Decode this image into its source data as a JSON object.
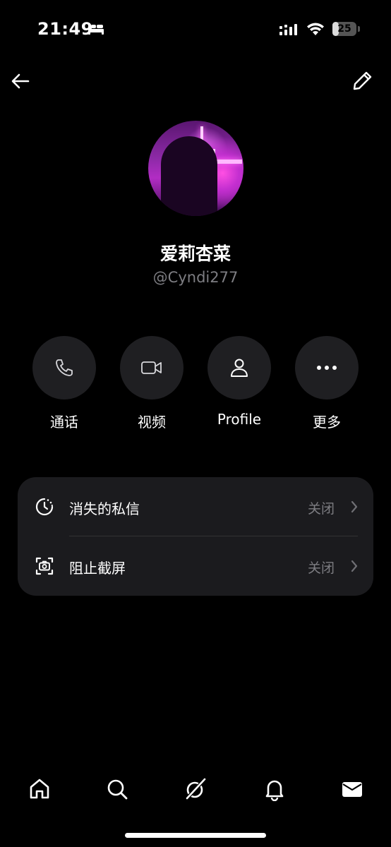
{
  "status_bar": {
    "time": "21:49",
    "battery_level": "25",
    "battery_fraction": 0.25
  },
  "profile": {
    "name": "爱莉杏菜",
    "handle": "@Cyndi277"
  },
  "actions": [
    {
      "label": "通话",
      "icon": "phone-icon"
    },
    {
      "label": "视频",
      "icon": "video-icon"
    },
    {
      "label": "Profile",
      "icon": "person-icon"
    },
    {
      "label": "更多",
      "icon": "more-icon"
    }
  ],
  "settings": [
    {
      "label": "消失的私信",
      "value": "关闭",
      "icon": "timer-icon"
    },
    {
      "label": "阻止截屏",
      "value": "关闭",
      "icon": "screenshot-icon"
    }
  ],
  "tab_bar": {
    "tabs": [
      "home-icon",
      "search-icon",
      "grok-icon",
      "bell-icon",
      "mail-icon"
    ]
  }
}
